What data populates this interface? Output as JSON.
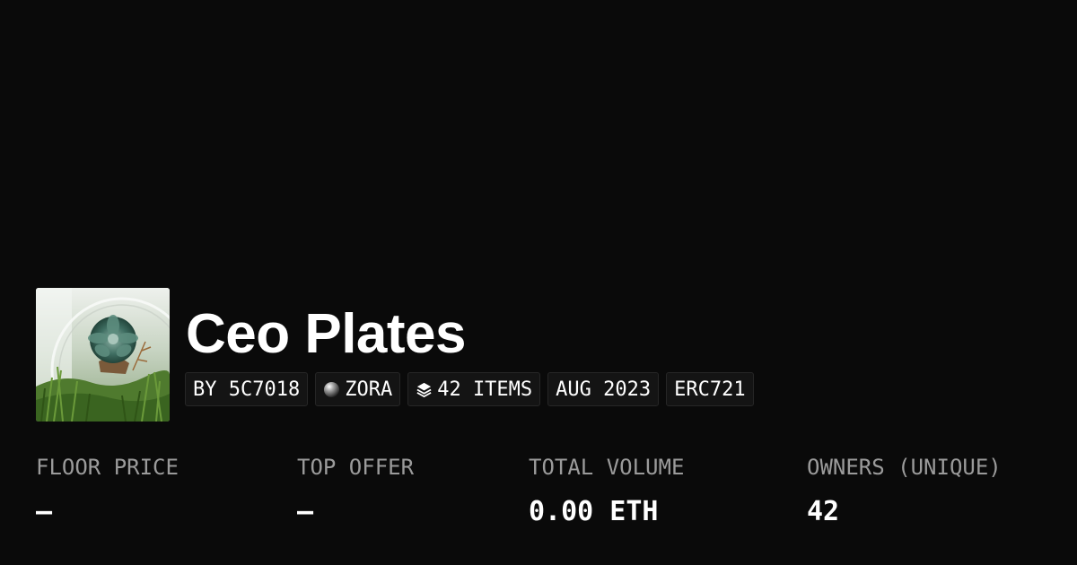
{
  "collection": {
    "title": "Ceo Plates",
    "thumbnail_icon": "succulent-terrarium-image"
  },
  "tags": [
    {
      "label": "BY 5C7018"
    },
    {
      "label": "ZORA",
      "icon": "zora-orb-icon"
    },
    {
      "label": "42 ITEMS",
      "icon": "stack-layers-icon"
    },
    {
      "label": "AUG 2023"
    },
    {
      "label": "ERC721"
    }
  ],
  "stats": [
    {
      "label": "FLOOR PRICE",
      "value": "–"
    },
    {
      "label": "TOP OFFER",
      "value": "–"
    },
    {
      "label": "TOTAL VOLUME",
      "value": "0.00 ETH"
    },
    {
      "label": "OWNERS (UNIQUE)",
      "value": "42"
    }
  ],
  "colors": {
    "background": "#0a0a0a",
    "text": "#ffffff",
    "muted_text": "#9b9b9b",
    "tag_background": "#141414",
    "tag_border": "#262626"
  }
}
